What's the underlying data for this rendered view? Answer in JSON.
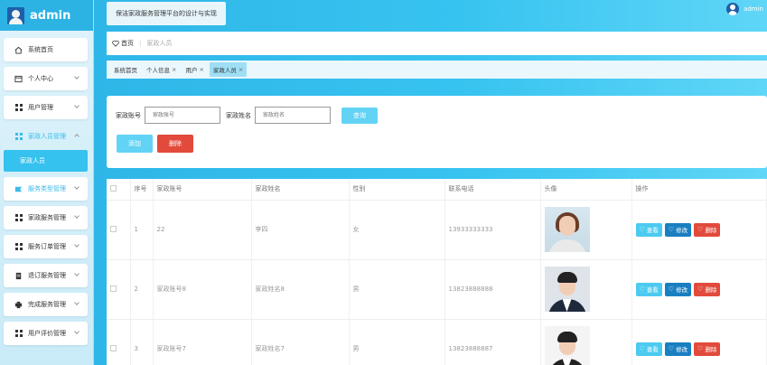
{
  "app": {
    "title": "admin"
  },
  "header": {
    "system_title": "保洁家政服务管理平台的设计与实现",
    "user_name": "admin"
  },
  "sidebar": {
    "items": [
      {
        "label": "系统首页",
        "icon": "home-icon"
      },
      {
        "label": "个人中心",
        "icon": "calendar-icon"
      },
      {
        "label": "用户管理",
        "icon": "grid-icon"
      },
      {
        "label": "家政人员管理",
        "icon": "grid-icon",
        "open": true,
        "sub": [
          {
            "label": "家政人员"
          }
        ]
      },
      {
        "label": "服务类型管理",
        "icon": "tag-icon"
      },
      {
        "label": "家政服务管理",
        "icon": "grid-icon"
      },
      {
        "label": "服务订单管理",
        "icon": "grid-icon"
      },
      {
        "label": "退订服务管理",
        "icon": "document-icon"
      },
      {
        "label": "完成服务管理",
        "icon": "printer-icon"
      },
      {
        "label": "用户评价管理",
        "icon": "grid-icon"
      }
    ]
  },
  "breadcrumb": {
    "home": "首页",
    "current": "家政人员"
  },
  "tabs": [
    {
      "label": "系统首页",
      "closable": false
    },
    {
      "label": "个人信息",
      "closable": true
    },
    {
      "label": "用户",
      "closable": true
    },
    {
      "label": "家政人员",
      "closable": true,
      "active": true
    }
  ],
  "search": {
    "account_label": "家政账号",
    "account_placeholder": "家政账号",
    "name_label": "家政姓名",
    "name_placeholder": "家政姓名",
    "query_label": "查询",
    "add_label": "添加",
    "delete_label": "删除"
  },
  "table": {
    "headers": [
      "序号",
      "家政账号",
      "家政姓名",
      "性别",
      "联系电话",
      "头像",
      "操作"
    ],
    "rows": [
      {
        "index": "1",
        "account": "22",
        "name": "李四",
        "gender": "女",
        "phone": "13933333333"
      },
      {
        "index": "2",
        "account": "家政账号8",
        "name": "家政姓名8",
        "gender": "男",
        "phone": "13823888888"
      },
      {
        "index": "3",
        "account": "家政账号7",
        "name": "家政姓名7",
        "gender": "男",
        "phone": "13823888887"
      }
    ],
    "actions": {
      "view": "查看",
      "edit": "修改",
      "delete": "删除"
    }
  },
  "colors": {
    "accent": "#35c2ee",
    "danger": "#e24a3b",
    "edit": "#1a7fc1"
  }
}
